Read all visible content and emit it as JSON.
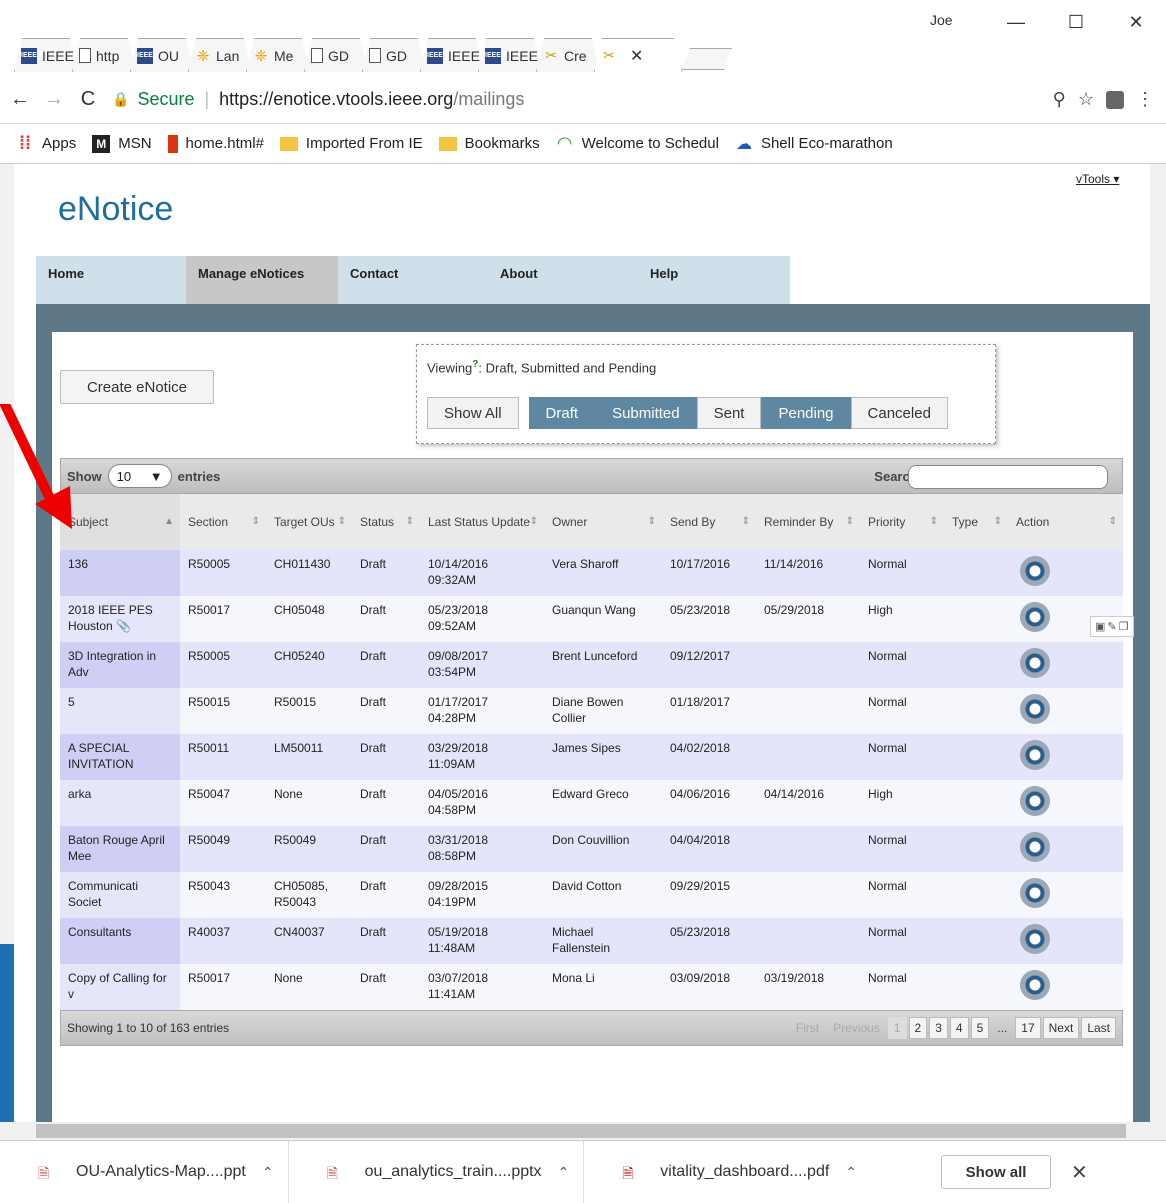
{
  "window": {
    "user": "Joe",
    "tabs": [
      {
        "icon": "ieee-icon",
        "label": "IEEE"
      },
      {
        "icon": "document-icon",
        "label": "http"
      },
      {
        "icon": "ieee-icon",
        "label": "OU"
      },
      {
        "icon": "network-icon",
        "label": "Lan"
      },
      {
        "icon": "network-icon",
        "label": "Me"
      },
      {
        "icon": "document-icon",
        "label": "GD"
      },
      {
        "icon": "document-icon",
        "label": "GD"
      },
      {
        "icon": "ieee-icon",
        "label": "IEEE"
      },
      {
        "icon": "ieee-icon",
        "label": "IEEE"
      },
      {
        "icon": "tools-icon",
        "label": "Cre"
      },
      {
        "icon": "tools-icon",
        "label": ""
      }
    ]
  },
  "address": {
    "secure": "Secure",
    "host": "https://enotice.vtools.ieee.org",
    "path": "/mailings"
  },
  "bookmarks": [
    "Apps",
    "MSN",
    "home.html#",
    "Imported From IE",
    "Bookmarks",
    "Welcome to Schedul",
    "Shell Eco-marathon"
  ],
  "page": {
    "vtools": "vTools ▾",
    "brand": "eNotice",
    "nav": [
      "Home",
      "Manage eNotices",
      "Contact",
      "About",
      "Help"
    ],
    "create_button": "Create eNotice",
    "viewing_prefix": "Viewing",
    "viewing_q": "?",
    "viewing_text": ": Draft, Submitted and Pending",
    "filters": [
      "Show All",
      "Draft",
      "Submitted",
      "Sent",
      "Pending",
      "Canceled"
    ],
    "show_label": "Show",
    "entries_value": "10",
    "entries_label": "entries",
    "search_label": "Search:",
    "columns": [
      "Subject",
      "Section",
      "Target OUs",
      "Status",
      "Last Status Update",
      "Owner",
      "Send By",
      "Reminder By",
      "Priority",
      "Type",
      "Action"
    ],
    "rows": [
      [
        "136",
        "R50005",
        "CH011430",
        "Draft",
        "10/14/2016 09:32AM",
        "Vera Sharoff",
        "10/17/2016",
        "11/14/2016",
        "Normal",
        ""
      ],
      [
        "2018 IEEE PES Houston",
        "R50017",
        "CH05048",
        "Draft",
        "05/23/2018 09:52AM",
        "Guanqun Wang",
        "05/23/2018",
        "05/29/2018",
        "High",
        ""
      ],
      [
        "3D Integration in Adv",
        "R50005",
        "CH05240",
        "Draft",
        "09/08/2017 03:54PM",
        "Brent Lunceford",
        "09/12/2017",
        "",
        "Normal",
        ""
      ],
      [
        "5",
        "R50015",
        "R50015",
        "Draft",
        "01/17/2017 04:28PM",
        "Diane Bowen Collier",
        "01/18/2017",
        "",
        "Normal",
        ""
      ],
      [
        "A SPECIAL INVITATION",
        "R50011",
        "LM50011",
        "Draft",
        "03/29/2018 11:09AM",
        "James Sipes",
        "04/02/2018",
        "",
        "Normal",
        ""
      ],
      [
        "arka",
        "R50047",
        "None",
        "Draft",
        "04/05/2016 04:58PM",
        "Edward Greco",
        "04/06/2016",
        "04/14/2016",
        "High",
        ""
      ],
      [
        "Baton Rouge April Mee",
        "R50049",
        "R50049",
        "Draft",
        "03/31/2018 08:58PM",
        "Don Couvillion",
        "04/04/2018",
        "",
        "Normal",
        ""
      ],
      [
        "Communicati Societ",
        "R50043",
        "CH05085, R50043",
        "Draft",
        "09/28/2015 04:19PM",
        "David Cotton",
        "09/29/2015",
        "",
        "Normal",
        ""
      ],
      [
        "Consultants",
        "R40037",
        "CN40037",
        "Draft",
        "05/19/2018 11:48AM",
        "Michael Fallenstein",
        "05/23/2018",
        "",
        "Normal",
        ""
      ],
      [
        "Copy of Calling for v",
        "R50017",
        "None",
        "Draft",
        "03/07/2018 11:41AM",
        "Mona Li",
        "03/09/2018",
        "03/19/2018",
        "Normal",
        ""
      ]
    ],
    "footer_info": "Showing 1 to 10 of 163 entries",
    "pager": [
      "First",
      "Previous",
      "1",
      "2",
      "3",
      "4",
      "5",
      "...",
      "17",
      "Next",
      "Last"
    ]
  },
  "downloads": [
    {
      "icon": "powerpoint-icon",
      "name": "OU-Analytics-Map....ppt"
    },
    {
      "icon": "powerpoint-icon",
      "name": "ou_analytics_train....pptx"
    },
    {
      "icon": "pdf-icon",
      "name": "vitality_dashboard....pdf"
    }
  ],
  "show_all": "Show all"
}
